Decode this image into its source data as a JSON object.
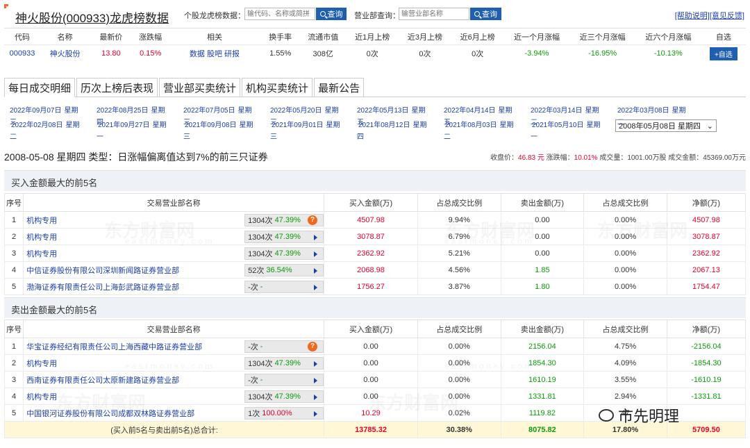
{
  "header": {
    "title": "神火股份(000933)龙虎榜数据",
    "stock_search_label": "个股龙虎榜数据：",
    "stock_search_placeholder": "输代码、名称或简拼",
    "query_label": "查询",
    "dept_search_label": "营业部查询：",
    "dept_search_placeholder": "输营业部名称",
    "help_link": "[帮助说明]",
    "feedback_link": "[意见反馈]"
  },
  "stock_info": {
    "headers": [
      "代码",
      "名称",
      "最新价",
      "涨跌幅",
      "相关",
      "换手率",
      "流通市值",
      "近1月上榜",
      "近3月上榜",
      "近6月上榜",
      "近一个月涨幅",
      "近三个月涨幅",
      "近六个月涨幅",
      "自选"
    ],
    "code": "000933",
    "name": "神火股份",
    "price": "13.80",
    "change": "0.15%",
    "related": [
      "数据",
      "股吧",
      "研报"
    ],
    "turnover": "1.55%",
    "market_cap": "308亿",
    "m1": "0次",
    "m3": "0次",
    "m6": "0次",
    "r1": "-3.94%",
    "r3": "-16.95%",
    "r6": "-10.13%",
    "add_label": "+自选"
  },
  "tabs": [
    "每日成交明细",
    "历次上榜后表现",
    "营业部买卖统计",
    "机构买卖统计",
    "最新公告"
  ],
  "dates_row1": [
    "2022年09月07日",
    "2022年08月25日",
    "2022年07月05日",
    "2022年05月20日",
    "2022年05月13日",
    "2022年04月14日",
    "2022年03月14日",
    "2022年03月08日"
  ],
  "dates_row1_weekdays": [
    "星期",
    "星期",
    "星期",
    "星期",
    "星期",
    "星期",
    "星期",
    "星期"
  ],
  "dates_row2": [
    "2022年02月08日",
    "2021年09月27日",
    "2021年09月08日",
    "2021年09月01日",
    "2021年08月12日",
    "2021年08月03日",
    "2021年05月10日"
  ],
  "dates_row2_weekdays": [
    "星期",
    "星期",
    "星期",
    "星期",
    "星期",
    "星期",
    "星期"
  ],
  "date_overlaps": [
    "三",
    "四",
    "三",
    "三",
    "五",
    "五",
    "二",
    "二"
  ],
  "date_wraps": [
    "二",
    "一",
    "三",
    "三",
    "四",
    "二",
    "一"
  ],
  "date_select": "2008年05月08日 星期四",
  "summary": {
    "text": "2008-05-08 星期四 类型：日涨幅偏离值达到7%的前三只证券",
    "close_label": "收盘价：",
    "close": "46.83 元",
    "chg_label": "涨跌幅：",
    "chg": "10.01%",
    "vol_label": "成交量：",
    "vol": "1001.00万股",
    "amt_label": "成交金额：",
    "amt": "45369.00万元"
  },
  "buy_section": {
    "title": "买入金额最大的前5名",
    "headers": [
      "序号",
      "交易营业部名称",
      "买入金额(万)",
      "占总成交比例",
      "卖出金额(万)",
      "占总成交比例",
      "净额(万)"
    ],
    "rows": [
      {
        "no": "1",
        "name": "机构专用",
        "cnt": "1304次",
        "pct": "47.39%",
        "buy": "4507.98",
        "bp": "9.94%",
        "sell": "0.00",
        "sp": "0.00%",
        "net": "4507.98"
      },
      {
        "no": "2",
        "name": "机构专用",
        "cnt": "1304次",
        "pct": "47.39%",
        "buy": "3078.87",
        "bp": "6.79%",
        "sell": "0.00",
        "sp": "0.00%",
        "net": "3078.87"
      },
      {
        "no": "3",
        "name": "机构专用",
        "cnt": "1304次",
        "pct": "47.39%",
        "buy": "2362.92",
        "bp": "5.21%",
        "sell": "0.00",
        "sp": "0.00%",
        "net": "2362.92"
      },
      {
        "no": "4",
        "name": "中信证券股份有限公司深圳新闻路证券营业部",
        "cnt": "52次",
        "pct": "36.54%",
        "buy": "2068.98",
        "bp": "4.56%",
        "sell": "1.85",
        "sp": "0.00%",
        "net": "2067.13"
      },
      {
        "no": "5",
        "name": "渤海证券有限责任公司上海彭武路证券营业部",
        "cnt": "-次",
        "pct": "-",
        "buy": "1756.27",
        "bp": "3.87%",
        "sell": "1.80",
        "sp": "0.00%",
        "net": "1754.47"
      }
    ]
  },
  "sell_section": {
    "title": "卖出金额最大的前5名",
    "headers": [
      "序号",
      "交易营业部名称",
      "买入金额(万)",
      "占总成交比例",
      "卖出金额(万)",
      "占总成交比例",
      "净额(万)"
    ],
    "rows": [
      {
        "no": "1",
        "name": "华宝证券经纪有限责任公司上海西藏中路证券营业部",
        "cnt": "-次",
        "pct": "-",
        "buy": "0.00",
        "bp": "0.00%",
        "sell": "2156.04",
        "sp": "4.75%",
        "net": "-2156.04"
      },
      {
        "no": "2",
        "name": "机构专用",
        "cnt": "1304次",
        "pct": "47.39%",
        "buy": "0.00",
        "bp": "0.00%",
        "sell": "1854.30",
        "sp": "4.09%",
        "net": "-1854.30"
      },
      {
        "no": "3",
        "name": "西南证券有限责任公司太原新建路证券营业部",
        "cnt": "-次",
        "pct": "-",
        "buy": "0.00",
        "bp": "0.00%",
        "sell": "1610.19",
        "sp": "3.55%",
        "net": "-1610.19"
      },
      {
        "no": "4",
        "name": "机构专用",
        "cnt": "1304次",
        "pct": "47.39%",
        "buy": "0.00",
        "bp": "0.00%",
        "sell": "1331.81",
        "sp": "2.94%",
        "net": "-1331.81"
      },
      {
        "no": "5",
        "name": "中国银河证券股份有限公司成都双林路证券营业部",
        "cnt": "1次",
        "pct": "100.00%",
        "buy": "10.29",
        "bp": "0.02%",
        "sell": "1119.82",
        "sp": "47",
        "net": ""
      }
    ],
    "total_label": "(买入前5名与卖出前5名)总合计:",
    "total": {
      "buy": "13785.32",
      "bp": "30.38%",
      "sell": "8075.82",
      "sp": "17.80%",
      "net": "5709.50"
    }
  },
  "watermark_cn": "东方财富网",
  "watermark_en": "eastmoney.com",
  "wechat_badge": "市先明理",
  "colors": {
    "accent": "#1f5fb0",
    "up": "#e4002b",
    "down": "#0b9b0b",
    "link": "#1b3fa8",
    "corner": "#ef6d28"
  }
}
